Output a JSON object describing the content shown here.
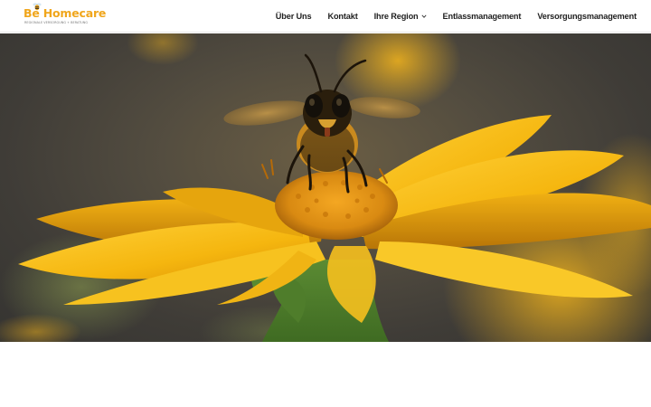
{
  "brand": {
    "name": "Be Homecare",
    "tagline": "REGIONALE VERSORGUNG + BERATUNG",
    "accent_color": "#f0a61c",
    "logo_icon": "bee-icon"
  },
  "nav": {
    "items": [
      {
        "label": "Über Uns"
      },
      {
        "label": "Kontakt"
      },
      {
        "label": "Ihre Region",
        "has_dropdown": true,
        "icon": "chevron-down-icon"
      },
      {
        "label": "Entlassmanagement"
      },
      {
        "label": "Versorgungsmanagement"
      }
    ]
  },
  "hero": {
    "image": "bee-on-yellow-flower-photo"
  }
}
